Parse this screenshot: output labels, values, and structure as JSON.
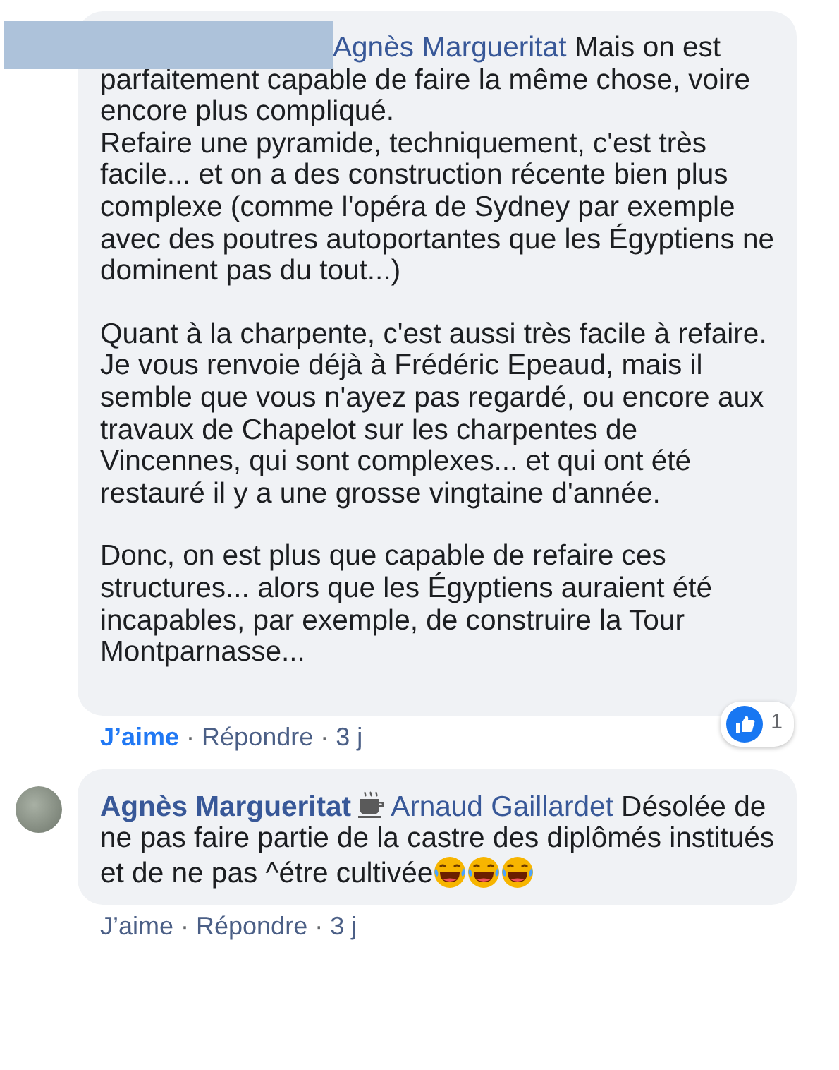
{
  "comments": [
    {
      "author_hidden": true,
      "mention": "Agnès Margueritat",
      "paragraphs": [
        {
          "lines": [
            "Mais on est parfaitement capable de faire la même chose, voire encore plus compliqué.",
            "Refaire une pyramide, techniquement, c'est très facile... et on a des construction récente bien plus complexe (comme l'opéra de Sydney par exemple avec des poutres autoportantes que les Égyptiens ne dominent pas du tout...)"
          ]
        },
        {
          "lines": [
            "Quant à la charpente, c'est aussi très facile à refaire. Je vous renvoie déjà à Frédéric Epeaud, mais il semble que vous n'ayez pas regardé, ou encore aux travaux de Chapelot sur les charpentes de Vincennes, qui sont complexes... et qui ont été restauré il y a une grosse vingtaine d'année."
          ]
        },
        {
          "lines": [
            "Donc, on est plus que capable de refaire ces structures... alors que les Égyptiens auraient été incapables, par exemple, de construire la Tour Montparnasse..."
          ]
        }
      ],
      "reaction_count": "1",
      "actions": [
        {
          "kind": "like",
          "label": "J’aime",
          "selected": true
        },
        {
          "kind": "separator",
          "label": "·"
        },
        {
          "kind": "reply",
          "label": "Répondre"
        },
        {
          "kind": "separator",
          "label": "·"
        },
        {
          "kind": "time",
          "label": "3 j"
        }
      ]
    },
    {
      "author_hidden": false,
      "author": "Agnès Margueritat",
      "badge_icon": true,
      "mention": "Arnaud Gaillardet",
      "paragraphs": [
        {
          "lines": [
            "Désolée de ne pas faire partie de la castre des diplômés institués et de ne pas ^étre cultivée"
          ]
        }
      ],
      "emojis": [
        {
          "kind": "laughing"
        },
        {
          "kind": "laughing"
        },
        {
          "kind": "laughing"
        }
      ],
      "actions": [
        {
          "kind": "like",
          "label": "J’aime",
          "selected": false
        },
        {
          "kind": "separator",
          "label": "·"
        },
        {
          "kind": "reply",
          "label": "Répondre"
        },
        {
          "kind": "separator",
          "label": "·"
        },
        {
          "kind": "time",
          "label": "3 j"
        }
      ]
    }
  ]
}
